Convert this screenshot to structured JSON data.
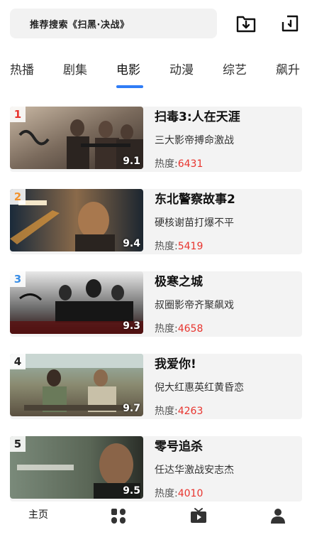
{
  "search": {
    "text": "推荐搜索《扫黑·决战》"
  },
  "tabs": [
    "热播",
    "剧集",
    "电影",
    "动漫",
    "综艺",
    "飙升"
  ],
  "active_tab": "电影",
  "heat_label": "热度:",
  "accent_color": "#2f7cf6",
  "heat_color": "#e8342e",
  "movies": [
    {
      "rank": "1",
      "rank_color": "#e8342e",
      "title": "扫毒3:人在天涯",
      "desc": "三大影帝搏命激战",
      "heat": "6431",
      "score": "9.1"
    },
    {
      "rank": "2",
      "rank_color": "#f2932f",
      "title": "东北警察故事2",
      "desc": "硬核谢苗打爆不平",
      "heat": "5419",
      "score": "9.4"
    },
    {
      "rank": "3",
      "rank_color": "#3a8ee6",
      "title": "极寒之城",
      "desc": "叔圈影帝齐聚飙戏",
      "heat": "4658",
      "score": "9.3"
    },
    {
      "rank": "4",
      "rank_color": "#222222",
      "title": "我爱你!",
      "desc": "倪大红惠英红黄昏恋",
      "heat": "4263",
      "score": "9.7"
    },
    {
      "rank": "5",
      "rank_color": "#222222",
      "title": "零号追杀",
      "desc": "任达华激战安志杰",
      "heat": "4010",
      "score": "9.5"
    }
  ],
  "bottom_nav": {
    "home": "主页"
  },
  "icons": [
    "download-folder-icon",
    "share-icon",
    "grid-icon",
    "tv-icon",
    "user-icon"
  ]
}
